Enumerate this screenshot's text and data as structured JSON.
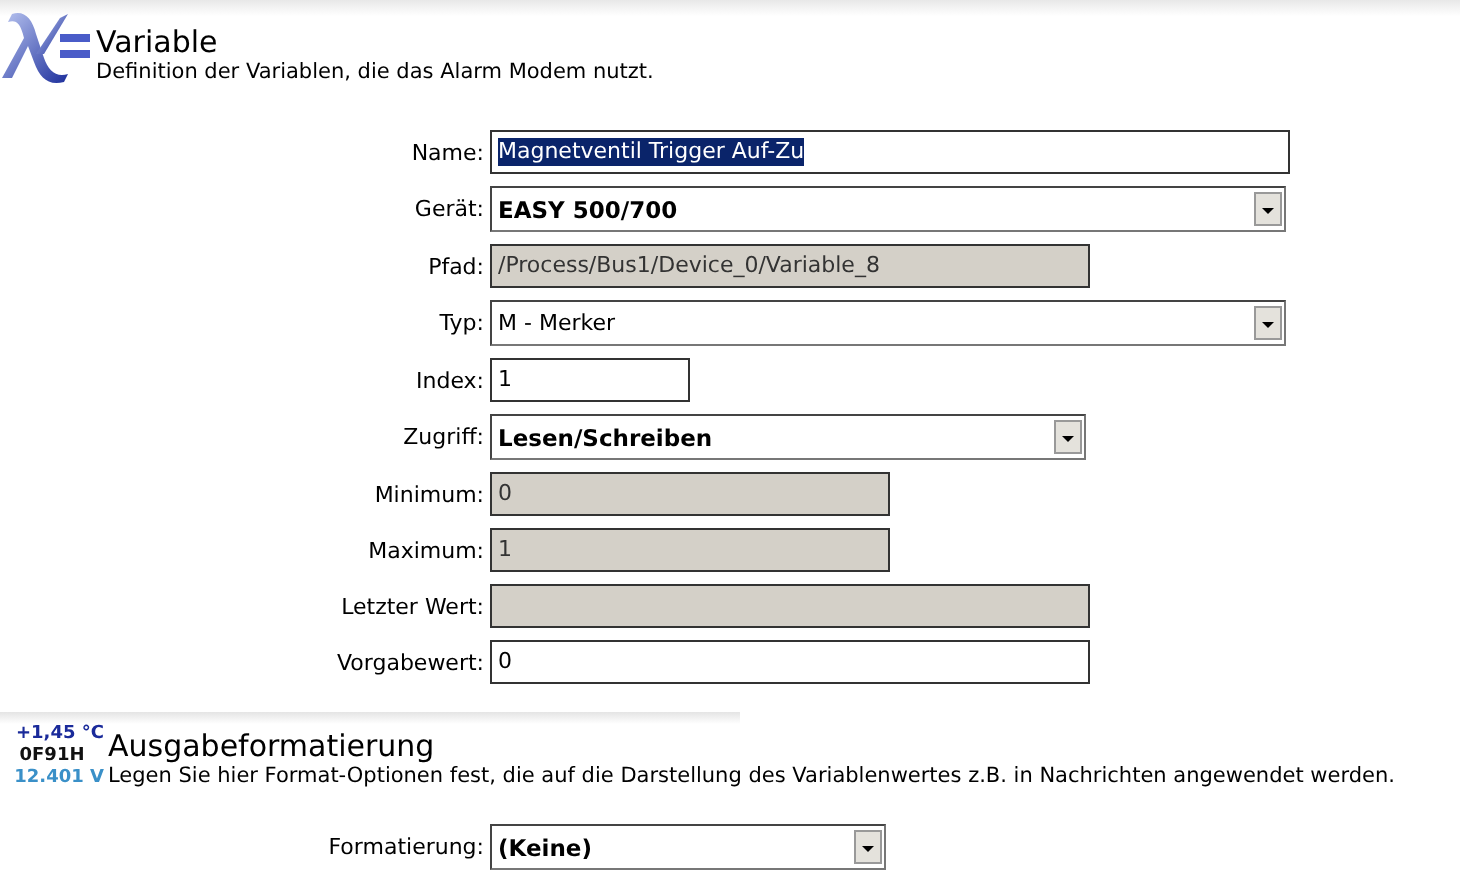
{
  "sections": [
    {
      "title": "Variable",
      "description": "Definition der Variablen, die das Alarm Modem nutzt.",
      "icon": {
        "kind": "formula"
      },
      "fields": [
        {
          "label": "Name:",
          "kind": "text",
          "value": "Magnetventil Trigger Auf-Zu",
          "highlighted": true,
          "bold": false
        },
        {
          "label": "Gerät:",
          "kind": "select",
          "value": "EASY 500/700",
          "highlighted": false,
          "bold": true
        },
        {
          "label": "Pfad:",
          "kind": "readonly",
          "value": "/Process/Bus1/Device_0/Variable_8",
          "highlighted": false,
          "bold": false
        },
        {
          "label": "Typ:",
          "kind": "select",
          "value": "M - Merker",
          "highlighted": false,
          "bold": false
        },
        {
          "label": "Index:",
          "kind": "text",
          "value": "1",
          "highlighted": false,
          "bold": false
        },
        {
          "label": "Zugriff:",
          "kind": "select",
          "value": "Lesen/Schreiben",
          "highlighted": false,
          "bold": true
        },
        {
          "label": "Minimum:",
          "kind": "readonly",
          "value": "0",
          "highlighted": false,
          "bold": false
        },
        {
          "label": "Maximum:",
          "kind": "readonly",
          "value": "1",
          "highlighted": false,
          "bold": false
        },
        {
          "label": "Letzter Wert:",
          "kind": "readonly",
          "highlighted": false
        },
        {
          "label": "Vorgabewert:",
          "kind": "text",
          "value": "0",
          "highlighted": false,
          "bold": false
        }
      ]
    },
    {
      "title": "Ausgabeformatierung",
      "description": "Legen Sie hier Format-Optionen fest, die auf die Darstellung des Variablenwertes z.B. in Nachrichten angewendet werden.",
      "icon": {
        "kind": "readout",
        "lines": [
          "+1,45 °C",
          "0F91H",
          "12.401 V"
        ]
      },
      "fields": [
        {
          "label": "Formatierung:",
          "kind": "select",
          "value": "(Keine)",
          "highlighted": false,
          "bold": true
        }
      ]
    }
  ]
}
